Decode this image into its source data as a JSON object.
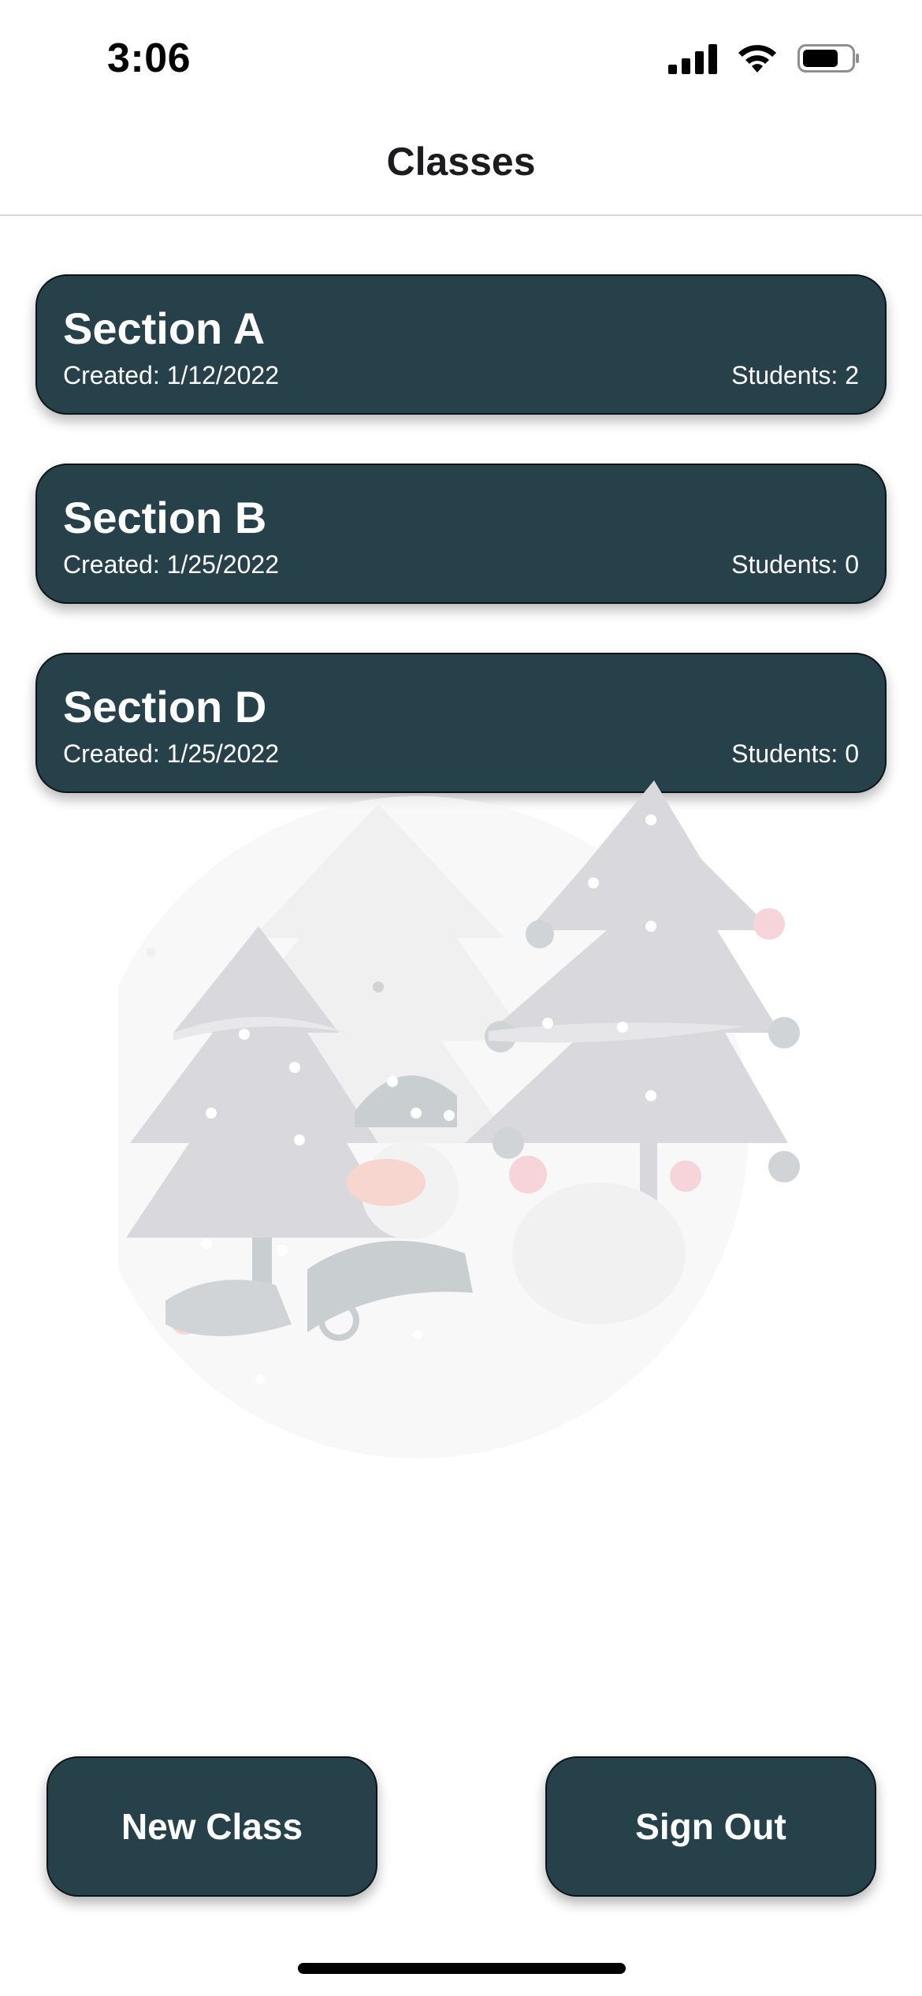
{
  "status_bar": {
    "time": "3:06",
    "icons": [
      "cellular-signal-icon",
      "wifi-icon",
      "battery-icon"
    ]
  },
  "nav": {
    "title": "Classes"
  },
  "classes": [
    {
      "name": "Section A",
      "created": "Created: 1/12/2022",
      "students": "Students: 2"
    },
    {
      "name": "Section B",
      "created": "Created: 1/25/2022",
      "students": "Students: 0"
    },
    {
      "name": "Section D",
      "created": "Created: 1/25/2022",
      "students": "Students: 0"
    }
  ],
  "actions": {
    "new_class_label": "New Class",
    "sign_out_label": "Sign Out"
  },
  "illustration": {
    "name": "winter-trees-snowman-illustration"
  },
  "colors": {
    "card_background": "#27414a",
    "card_text": "#ffffff",
    "page_background": "#ffffff",
    "divider": "#d6d6d6"
  }
}
